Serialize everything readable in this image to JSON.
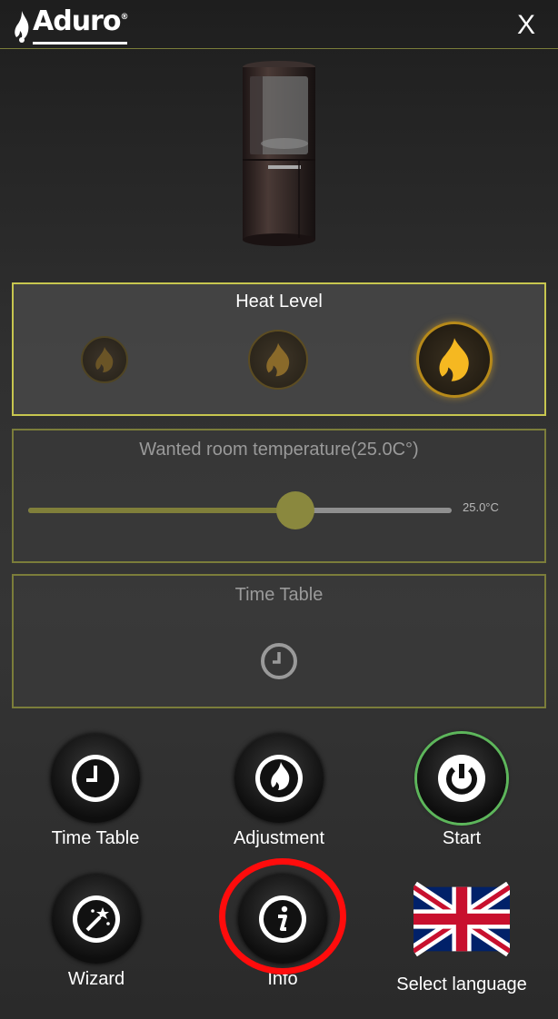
{
  "header": {
    "logo_text": "Aduro",
    "logo_mark": "®",
    "close_label": "X"
  },
  "heat_level": {
    "title": "Heat Level",
    "levels": [
      "low",
      "medium",
      "high"
    ],
    "selected_level": 3
  },
  "temperature": {
    "title": "Wanted room temperature(25.0C°)",
    "value_label": "25.0°C",
    "slider_fraction": 0.63
  },
  "time_table_panel": {
    "title": "Time Table"
  },
  "buttons": {
    "time_table": "Time Table",
    "adjustment": "Adjustment",
    "start": "Start",
    "wizard": "Wizard",
    "info": "Info",
    "select_language": "Select language"
  },
  "colors": {
    "accent": "#7b7d3a",
    "flame_active": "#f5b821",
    "power_ring": "#5db65b",
    "highlight_ring": "#ff0c0c"
  }
}
